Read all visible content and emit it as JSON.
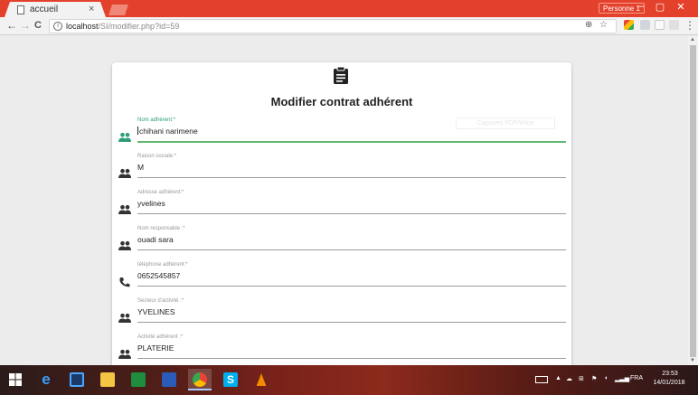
{
  "browser": {
    "tab_title": "accueil",
    "tab_close": "×",
    "profile": "Personne 1",
    "url_host": "localhost",
    "url_path": "/SI/modifier.php?id=59",
    "window_controls": {
      "minimize": "–",
      "maximize": "▢",
      "close": "✕"
    },
    "nav": {
      "back": "←",
      "forward": "→",
      "reload": "C"
    },
    "zoom_icon": "⊕",
    "bookmark_icon": "☆",
    "menu": "⋮"
  },
  "form": {
    "icon": "clipboard-icon",
    "title": "Modifier contrat adhérent",
    "ghost_button": "Captures PDF/Write",
    "fields": [
      {
        "label": "Nom adhérent:*",
        "value": "chihani narimene",
        "icon": "people-icon",
        "focused": true
      },
      {
        "label": "Raison sociale:*",
        "value": "M",
        "icon": "people-icon",
        "focused": false
      },
      {
        "label": "Adresse adhérent:*",
        "value": "yvelines",
        "icon": "people-icon",
        "focused": false
      },
      {
        "label": "Nom responsable :*",
        "value": "ouadi sara",
        "icon": "people-icon",
        "focused": false
      },
      {
        "label": "téléphone adhérent:*",
        "value": "0652545857",
        "icon": "phone-icon",
        "focused": false
      },
      {
        "label": "Secteur d'activité :*",
        "value": "YVELINES",
        "icon": "people-icon",
        "focused": false
      },
      {
        "label": "Activité adhérent :*",
        "value": "PLATERIE",
        "icon": "people-icon",
        "focused": false
      }
    ]
  },
  "colors": {
    "titlebar": "#e4412c",
    "accent_green": "#5fb86f",
    "label_active": "#2e9c7a",
    "icon_teal": "#2e9c7a",
    "icon_dark": "#333333"
  },
  "taskbar": {
    "apps": [
      "start-icon",
      "edge-icon",
      "taskview-icon",
      "explorer-icon",
      "store-icon",
      "media-icon",
      "chrome-icon",
      "skype-icon",
      "vlc-icon"
    ],
    "language": "FRA",
    "time": "23:53",
    "date": "14/01/2018"
  }
}
